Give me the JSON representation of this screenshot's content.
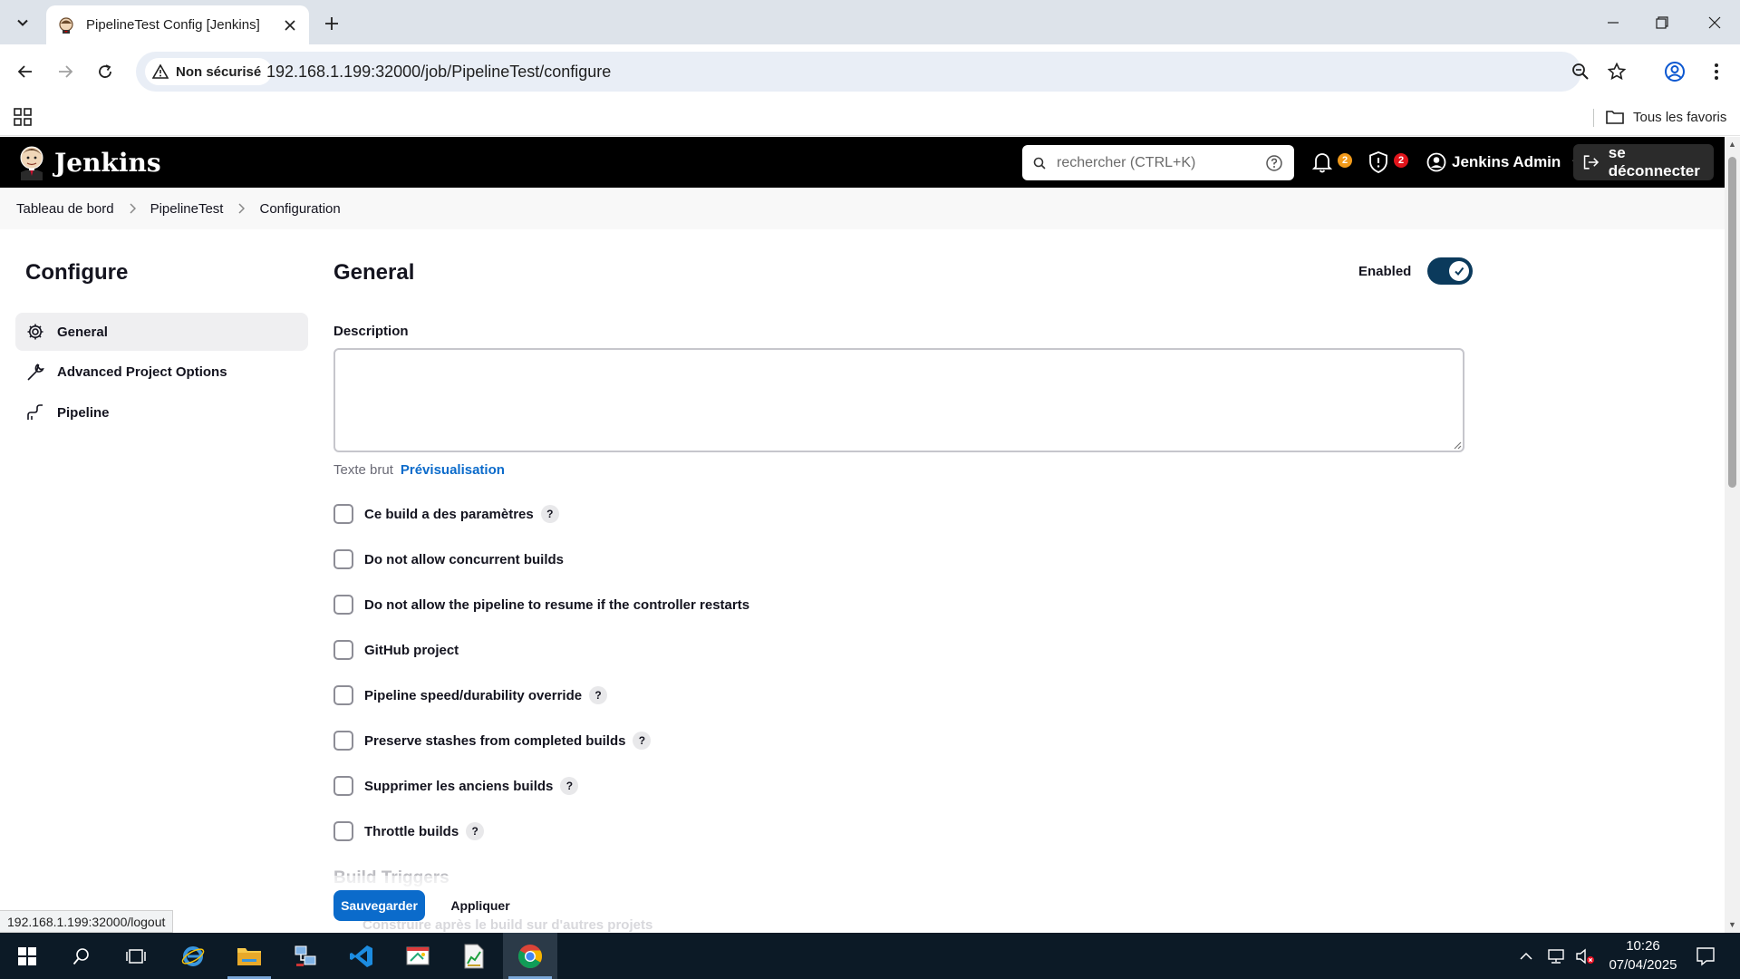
{
  "browser": {
    "tab_title": "PipelineTest Config [Jenkins]",
    "security_label": "Non sécurisé",
    "url": "192.168.1.199:32000/job/PipelineTest/configure",
    "bookmarks_all": "Tous les favoris",
    "status_url": "192.168.1.199:32000/logout"
  },
  "jenkins": {
    "brand": "Jenkins",
    "search_placeholder": "rechercher (CTRL+K)",
    "notifications_count": "2",
    "security_count": "2",
    "user_name": "Jenkins Admin",
    "logout_label": "se déconnecter",
    "colors": {
      "notif": "#f29a1a",
      "security": "#e1141b",
      "primary": "#0b6bcb",
      "toggle": "#0b3a5c"
    }
  },
  "breadcrumbs": [
    "Tableau de bord",
    "PipelineTest",
    "Configuration"
  ],
  "sidebar": {
    "title": "Configure",
    "items": [
      {
        "label": "General",
        "icon": "gear-icon",
        "active": true
      },
      {
        "label": "Advanced Project Options",
        "icon": "wrench-icon",
        "active": false
      },
      {
        "label": "Pipeline",
        "icon": "pipeline-icon",
        "active": false
      }
    ]
  },
  "general": {
    "title": "General",
    "enabled_label": "Enabled",
    "enabled": true,
    "description_label": "Description",
    "description_value": "",
    "format_plain": "Texte brut",
    "format_preview": "Prévisualisation",
    "options": [
      {
        "label": "Ce build a des paramètres",
        "help": true,
        "checked": false
      },
      {
        "label": "Do not allow concurrent builds",
        "help": false,
        "checked": false
      },
      {
        "label": "Do not allow the pipeline to resume if the controller restarts",
        "help": false,
        "checked": false
      },
      {
        "label": "GitHub project",
        "help": false,
        "checked": false
      },
      {
        "label": "Pipeline speed/durability override",
        "help": true,
        "checked": false
      },
      {
        "label": "Preserve stashes from completed builds",
        "help": true,
        "checked": false
      },
      {
        "label": "Supprimer les anciens builds",
        "help": true,
        "checked": false
      },
      {
        "label": "Throttle builds",
        "help": true,
        "checked": false
      }
    ],
    "help_glyph": "?",
    "next_section_title": "Build Triggers",
    "next_section_first_option": "Construire après le build sur d'autres projets"
  },
  "actions": {
    "save": "Sauvegarder",
    "apply": "Appliquer"
  },
  "taskbar": {
    "time": "10:26",
    "date": "07/04/2025"
  }
}
